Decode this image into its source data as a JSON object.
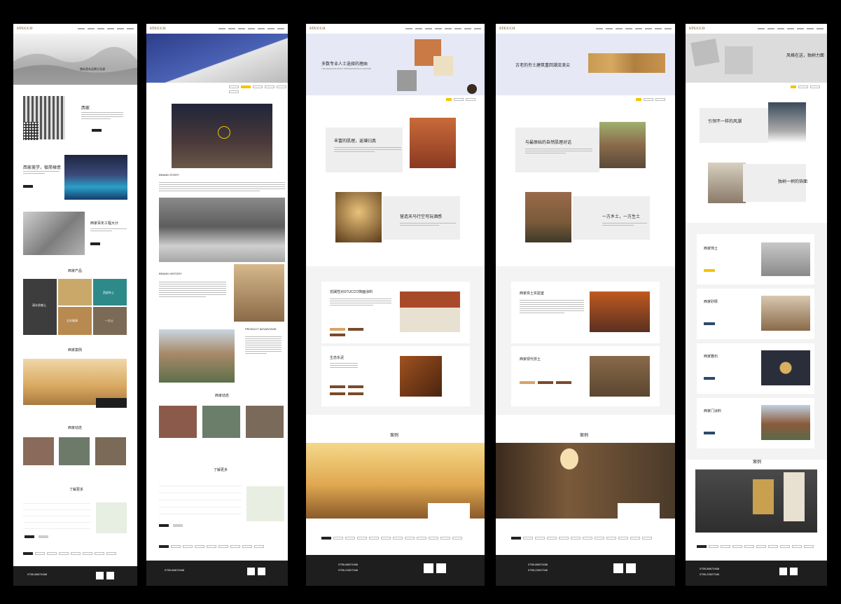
{
  "page_brand": "STUCCO",
  "p1": {
    "hero_line": "陕标是本品牌主导源",
    "s1_title": "西家",
    "s2_title": "西家美学，极简禅意",
    "s3_title": "西家百年工程大计",
    "products_title": "西家产品",
    "prod_tiles": [
      "清水质感土",
      "",
      "西部夯土",
      "",
      "石木格调",
      "一方土"
    ],
    "cases_title": "西家案例",
    "news_title": "西家动态",
    "contact_title": "了解更多",
    "footer_tel": "0755-86672468"
  },
  "p2": {
    "brand_story": "BRAND STORY",
    "history": "BRAND HISTORY",
    "advantage": "PRODUCT ADVANTAGE",
    "news_title": "西家动态",
    "contact_title": "了解更多",
    "footer_tel": "0755-86672468"
  },
  "p3": {
    "banner_title": "多数专业人士选择的理由",
    "banner_sub": "THE REASONS MOST PROFESSIONALS CHOOSE",
    "r1_title": "丰富的肌理，返璞归真",
    "r2_title": "营造天马行空可玩酒感",
    "c1_title": "抗碱性对STUCCO饰面涂料",
    "c2_title": "生态东泥",
    "cases_title": "案例",
    "footer_tel": "0755-86672468",
    "footer_tel2": "0755-22627346"
  },
  "p4": {
    "banner_title": "古老的夯土建筑重回潮流浪尖",
    "r1_title": "与最原始的自然肌理对话",
    "r2_title": "一方乡土，一方生土",
    "c1_title": "西家夯土实验室",
    "c2_title": "西家现代夯土",
    "cases_title": "案例",
    "footer_tel": "0755-86672468",
    "footer_tel2": "0755-22627346"
  },
  "p5": {
    "banner_title": "风格在这，独树力面",
    "r1_title": "引领不一样的风潮",
    "r2_title": "独树一帜的饰面",
    "items": [
      "西家饰土",
      "西家砂砾",
      "西家雅石",
      "西家门涂料"
    ],
    "cases_title": "案例",
    "footer_tel": "0755-86672468",
    "footer_tel2": "0755-22627346"
  },
  "colors": {
    "background": "#000000",
    "footer": "#1e1e1e",
    "brown_accent": "#7a5b2e",
    "orange_tag": "#d9a268",
    "teal_tile": "#2d8a88",
    "yellow_tab": "#f4c400",
    "lavender_banner": "#e7e8f5"
  }
}
